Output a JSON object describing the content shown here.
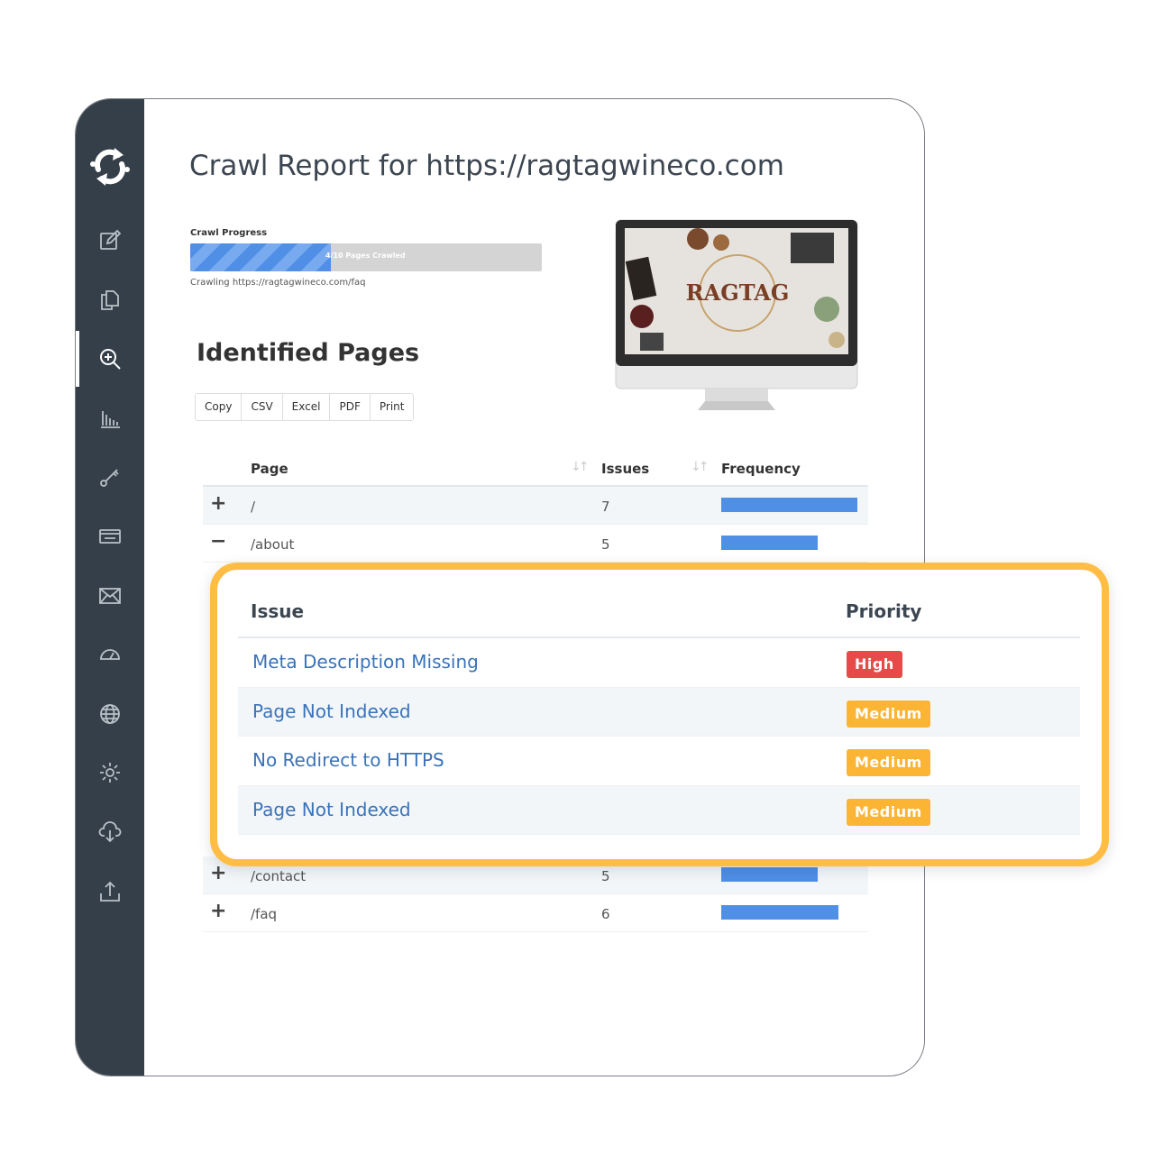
{
  "header": {
    "title": "Crawl Report for https://ragtagwineco.com"
  },
  "progress": {
    "label": "Crawl Progress",
    "fraction": 0.4,
    "text": "4/10 Pages Crawled",
    "crawling": "Crawling https://ragtagwineco.com/faq"
  },
  "preview": {
    "brand": "RAGTAG"
  },
  "pages_section": {
    "title": "Identified Pages",
    "buttons": [
      "Copy",
      "CSV",
      "Excel",
      "PDF",
      "Print"
    ],
    "columns": {
      "page": "Page",
      "issues": "Issues",
      "frequency": "Frequency"
    },
    "rows_top": [
      {
        "toggle": "+",
        "page": "/",
        "issues": "7",
        "frequency": 0.85,
        "shade": true
      },
      {
        "toggle": "−",
        "page": "/about",
        "issues": "5",
        "frequency": 0.6,
        "shade": false
      }
    ],
    "rows_bottom": [
      {
        "toggle": "+",
        "page": "/contact",
        "issues": "5",
        "frequency": 0.6,
        "shade": true
      },
      {
        "toggle": "+",
        "page": "/faq",
        "issues": "6",
        "frequency": 0.73,
        "shade": false
      }
    ]
  },
  "issue_detail": {
    "columns": {
      "issue": "Issue",
      "priority": "Priority"
    },
    "rows": [
      {
        "issue": "Meta Description Missing",
        "priority": "High",
        "color": "#e84a4a"
      },
      {
        "issue": "Page Not Indexed",
        "priority": "Medium",
        "color": "#fbb434"
      },
      {
        "issue": "No Redirect to HTTPS",
        "priority": "Medium",
        "color": "#fbb434"
      },
      {
        "issue": "Page Not Indexed",
        "priority": "Medium",
        "color": "#fbb434"
      }
    ]
  },
  "sidebar": {
    "icons": [
      "edit-icon",
      "copy-icon",
      "search-icon",
      "chart-icon",
      "key-icon",
      "card-icon",
      "mail-icon",
      "gauge-icon",
      "globe-icon",
      "gear-icon",
      "cloud-download-icon",
      "upload-icon"
    ],
    "active_index": 2
  },
  "colors": {
    "sidebar": "#353f49",
    "accent": "#4f8fe6",
    "highlight": "#ffbd45",
    "link": "#3a73b9"
  }
}
